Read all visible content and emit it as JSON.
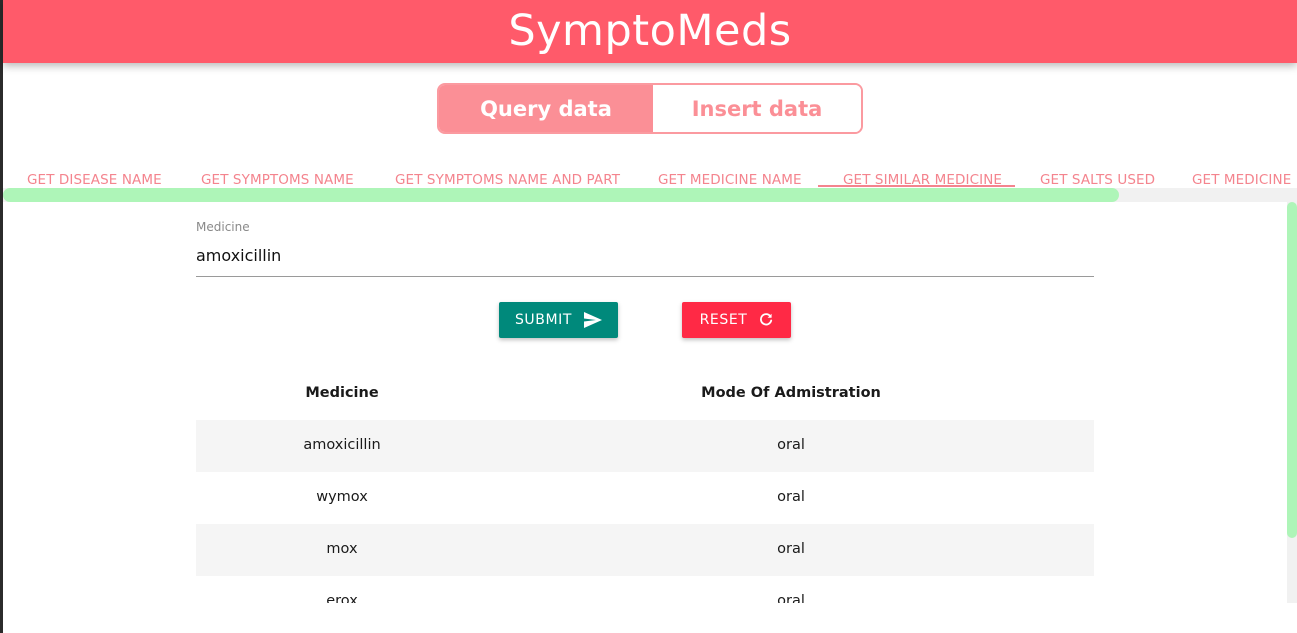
{
  "app": {
    "title": "SymptoMeds"
  },
  "mode_toggle": {
    "query_label": "Query data",
    "insert_label": "Insert data",
    "active": "query"
  },
  "tabs": [
    {
      "label": "GET DISEASE NAME"
    },
    {
      "label": "GET SYMPTOMS NAME"
    },
    {
      "label": "GET SYMPTOMS NAME AND PART"
    },
    {
      "label": "GET MEDICINE NAME"
    },
    {
      "label": "GET SIMILAR MEDICINE"
    },
    {
      "label": "GET SALTS USED"
    },
    {
      "label": "GET MEDICINE NAME"
    }
  ],
  "active_tab": "GET SIMILAR MEDICINE",
  "form": {
    "medicine_label": "Medicine",
    "medicine_value": "amoxicillin",
    "submit_label": "SUBMIT",
    "reset_label": "RESET"
  },
  "table": {
    "headers": [
      "Medicine",
      "Mode Of Admistration"
    ],
    "rows": [
      [
        "amoxicillin",
        "oral"
      ],
      [
        "wymox",
        "oral"
      ],
      [
        "mox",
        "oral"
      ],
      [
        "erox",
        "oral"
      ]
    ]
  },
  "colors": {
    "header_bg": "#ff5a6a",
    "accent_pink": "#fb8f96",
    "submit_bg": "#00897b",
    "reset_bg": "#ff2945",
    "scroll_thumb": "#aef5b8"
  },
  "icons": {
    "submit": "send-icon",
    "reset": "refresh-icon"
  }
}
